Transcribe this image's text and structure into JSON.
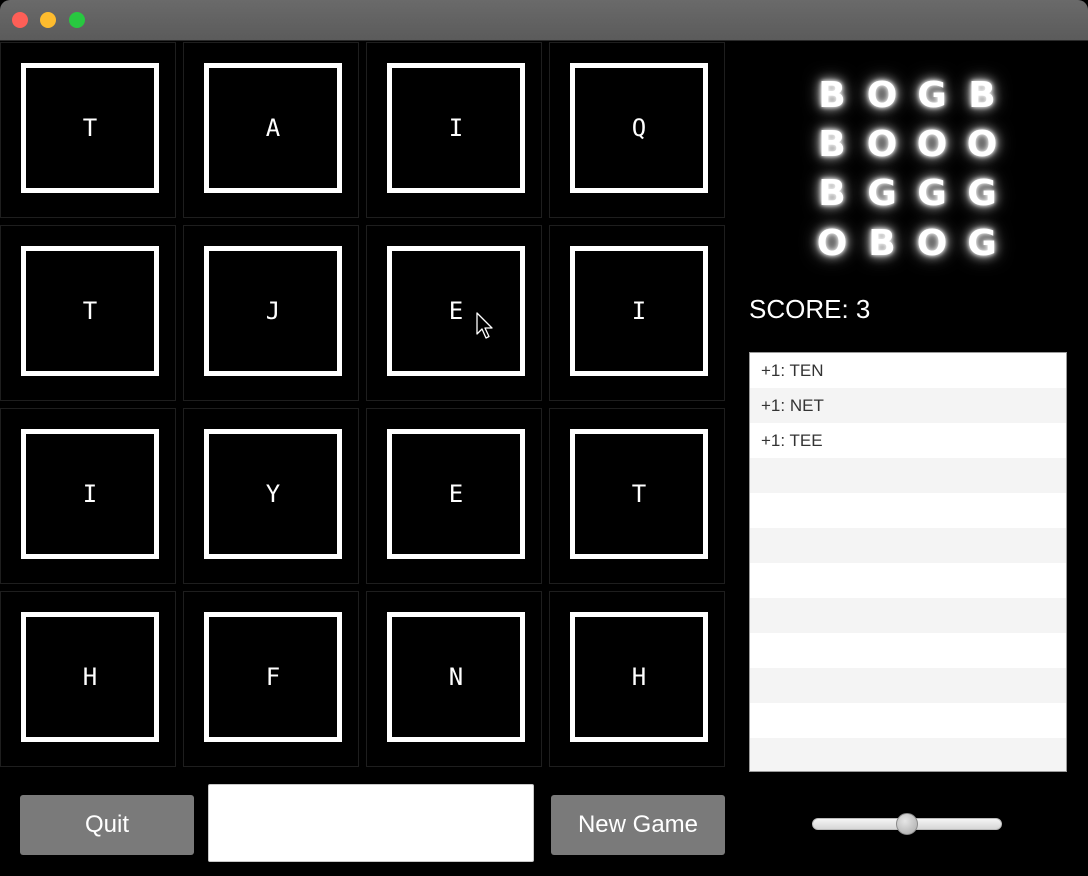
{
  "window": {
    "controls": [
      "close",
      "minimize",
      "maximize"
    ]
  },
  "board": {
    "rows": [
      [
        "T",
        "A",
        "I",
        "Q"
      ],
      [
        "T",
        "J",
        "E",
        "I"
      ],
      [
        "I",
        "Y",
        "E",
        "T"
      ],
      [
        "H",
        "F",
        "N",
        "H"
      ]
    ]
  },
  "logo": {
    "rows": [
      [
        "B",
        "O",
        "G",
        "B"
      ],
      [
        "B",
        "O",
        "O",
        "O"
      ],
      [
        "B",
        "G",
        "G",
        "G"
      ],
      [
        "O",
        "B",
        "O",
        "G"
      ]
    ]
  },
  "score": {
    "text": "SCORE: 3"
  },
  "word_list": {
    "items": [
      "+1: TEN",
      "+1: NET",
      "+1: TEE",
      "",
      "",
      "",
      "",
      "",
      "",
      "",
      "",
      ""
    ]
  },
  "controls": {
    "quit_label": "Quit",
    "new_game_label": "New Game",
    "word_input_value": "",
    "slider_fraction": 0.5
  },
  "colors": {
    "background": "#000000",
    "tile_border": "#ffffff",
    "button_bg": "#7a7a7a"
  }
}
